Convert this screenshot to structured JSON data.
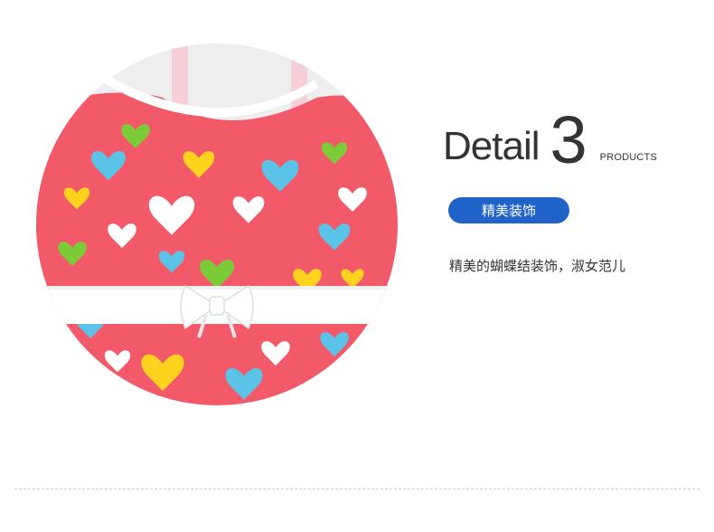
{
  "headline": {
    "word": "Detail",
    "number": "3",
    "suffix": "PRODUCTS"
  },
  "badge": {
    "label": "精美装饰",
    "color": "#1f63c9"
  },
  "description": "精美的蝴蝶结装饰，淑女范儿",
  "photo": {
    "icon": "product-detail-photo",
    "fabric_color": "#f25a6a",
    "accent_colors": [
      "#ffd21e",
      "#5cc3e8",
      "#7ccc3a",
      "#ffffff"
    ]
  }
}
